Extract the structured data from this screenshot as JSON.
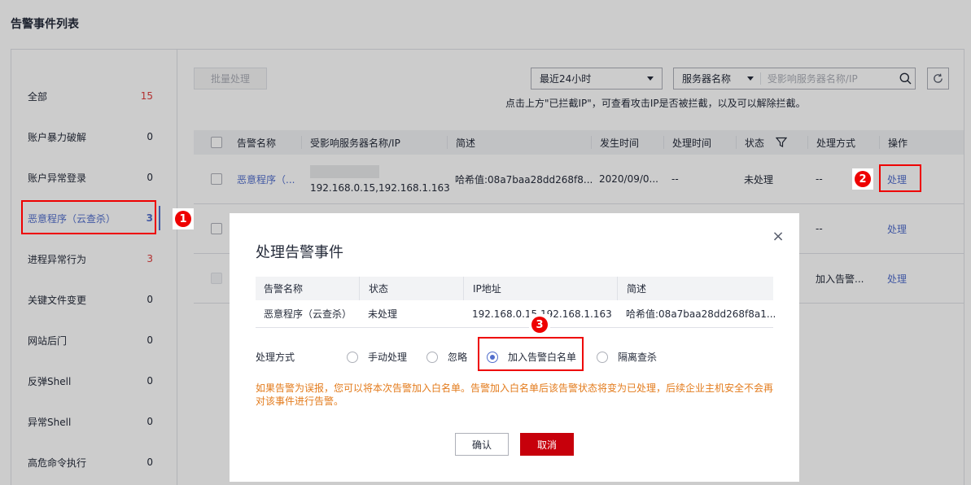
{
  "page_title": "告警事件列表",
  "sidebar": {
    "items": [
      {
        "label": "全部",
        "count": "15"
      },
      {
        "label": "账户暴力破解",
        "count": "0"
      },
      {
        "label": "账户异常登录",
        "count": "0"
      },
      {
        "label": "恶意程序（云查杀）",
        "count": "3"
      },
      {
        "label": "进程异常行为",
        "count": "3"
      },
      {
        "label": "关键文件变更",
        "count": "0"
      },
      {
        "label": "网站后门",
        "count": "0"
      },
      {
        "label": "反弹Shell",
        "count": "0"
      },
      {
        "label": "异常Shell",
        "count": "0"
      },
      {
        "label": "高危命令执行",
        "count": "0"
      }
    ]
  },
  "toolbar": {
    "batch_label": "批量处理",
    "time_select": "最近24小时",
    "server_type": "服务器名称",
    "search_placeholder": "受影响服务器名称/IP",
    "hint": "点击上方\"已拦截IP\"，可查看攻击IP是否被拦截，以及可以解除拦截。"
  },
  "table": {
    "headers": [
      "告警名称",
      "受影响服务器名称/IP",
      "简述",
      "发生时间",
      "处理时间",
      "状态",
      "处理方式",
      "操作"
    ],
    "rows": [
      {
        "name": "恶意程序（...",
        "server": "192.168.0.15,192.168.1.163",
        "desc": "哈希值:08a7baa28dd268f8...",
        "time": "2020/09/0...",
        "handled_time": "--",
        "status": "未处理",
        "method": "--",
        "action": "处理"
      },
      {
        "method": "--",
        "action": "处理"
      },
      {
        "method": "加入告警...",
        "action": "处理"
      }
    ]
  },
  "dialog": {
    "title": "处理告警事件",
    "close_icon": "×",
    "headers": [
      "告警名称",
      "状态",
      "IP地址",
      "简述"
    ],
    "row": {
      "name": "恶意程序（云查杀）",
      "status": "未处理",
      "ip": "192.168.0.15,192.168.1.163",
      "desc": "哈希值:08a7baa28dd268f8a1..."
    },
    "method_label": "处理方式",
    "options": [
      "手动处理",
      "忽略",
      "加入告警白名单",
      "隔离查杀"
    ],
    "selected_option": "加入告警白名单",
    "warning": "如果告警为误报，您可以将本次告警加入白名单。告警加入白名单后该告警状态将变为已处理，后续企业主机安全不会再对该事件进行告警。",
    "ok_label": "确认",
    "cancel_label": "取消"
  },
  "annotations": {
    "step1": "1",
    "step2": "2",
    "step3": "3"
  },
  "colors": {
    "accent": "#526ecc",
    "danger": "#c7000b",
    "warning_text": "#e37b1c",
    "annotation": "#ee0000"
  }
}
